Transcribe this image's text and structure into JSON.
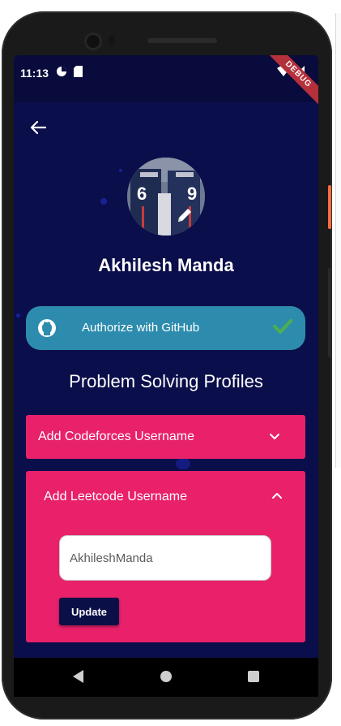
{
  "status_bar": {
    "time": "11:13",
    "debug_label": "DEBUG"
  },
  "profile": {
    "name": "Akhilesh Manda",
    "avatar_jersey_left": "6",
    "avatar_jersey_right": "9"
  },
  "github": {
    "label": "Authorize with GitHub",
    "authorized": true
  },
  "section": {
    "title": "Problem Solving Profiles"
  },
  "codeforces": {
    "label": "Add Codeforces Username",
    "expanded": false
  },
  "leetcode": {
    "label": "Add Leetcode Username",
    "expanded": true,
    "username_value": "AkhileshManda",
    "update_label": "Update"
  },
  "colors": {
    "background": "#0a0e4a",
    "panel": "#e8216a",
    "github_button": "#2d8cad",
    "check": "#4caf50",
    "update_button": "#0b0f47"
  },
  "icons": {
    "back": "arrow-left-icon",
    "edit": "pencil-icon",
    "github": "github-icon",
    "check": "check-icon",
    "expand": "chevron-down-icon",
    "collapse": "chevron-up-icon",
    "nav_back": "triangle-back-icon",
    "nav_home": "circle-home-icon",
    "nav_recents": "square-recents-icon"
  }
}
